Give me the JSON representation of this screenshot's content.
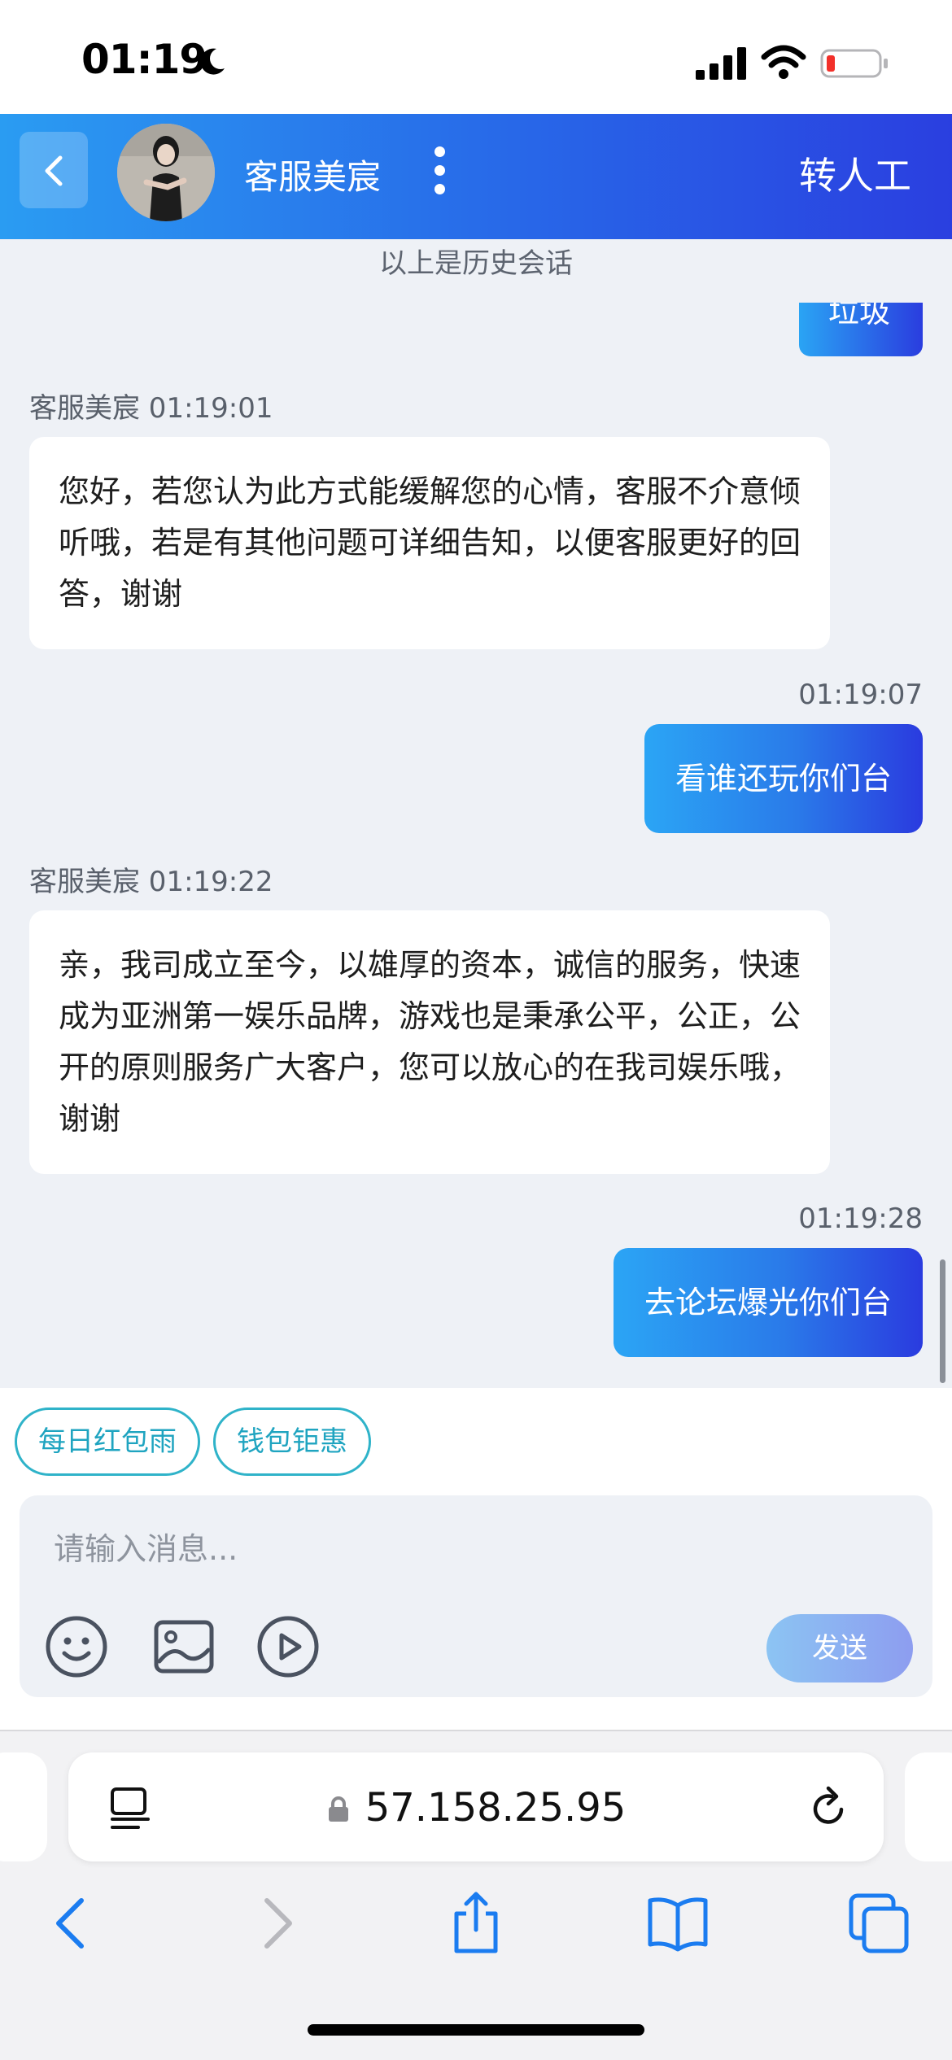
{
  "status_bar": {
    "time": "01:19",
    "icons": [
      "moon-icon",
      "cellular-signal-icon",
      "wifi-icon",
      "battery-low-icon"
    ]
  },
  "header": {
    "agent_name": "客服美宸",
    "transfer_label": "转人工",
    "colors": {
      "gradient_start": "#2a9cf2",
      "gradient_end": "#2a3fe0"
    }
  },
  "chat": {
    "history_note": "以上是历史会话",
    "partial_message": "垃圾",
    "messages": [
      {
        "side": "left",
        "sender": "客服美宸",
        "time": "01:19:01",
        "meta": "客服美宸  01:19:01",
        "text": "您好，若您认为此方式能缓解您的心情，客服不介意倾听哦，若是有其他问题可详细告知，以便客服更好的回答，谢谢"
      },
      {
        "side": "right",
        "time": "01:19:07",
        "text": "看谁还玩你们台"
      },
      {
        "side": "left",
        "sender": "客服美宸",
        "time": "01:19:22",
        "meta": "客服美宸  01:19:22",
        "text": "亲，我司成立至今，以雄厚的资本，诚信的服务，快速成为亚洲第一娱乐品牌，游戏也是秉承公平，公正，公开的原则服务广大客户，您可以放心的在我司娱乐哦，谢谢"
      },
      {
        "side": "right",
        "time": "01:19:28",
        "text": "去论坛爆光你们台"
      }
    ]
  },
  "quick_replies": [
    "每日红包雨",
    "钱包钜惠"
  ],
  "composer": {
    "placeholder": "请输入消息...",
    "value": "",
    "send_label": "发送",
    "tools": [
      "emoji-icon",
      "image-icon",
      "video-play-icon"
    ]
  },
  "browser": {
    "url": "57.158.25.95",
    "nav": [
      "back-icon",
      "forward-icon",
      "share-icon",
      "bookmarks-icon",
      "tabs-icon"
    ]
  }
}
